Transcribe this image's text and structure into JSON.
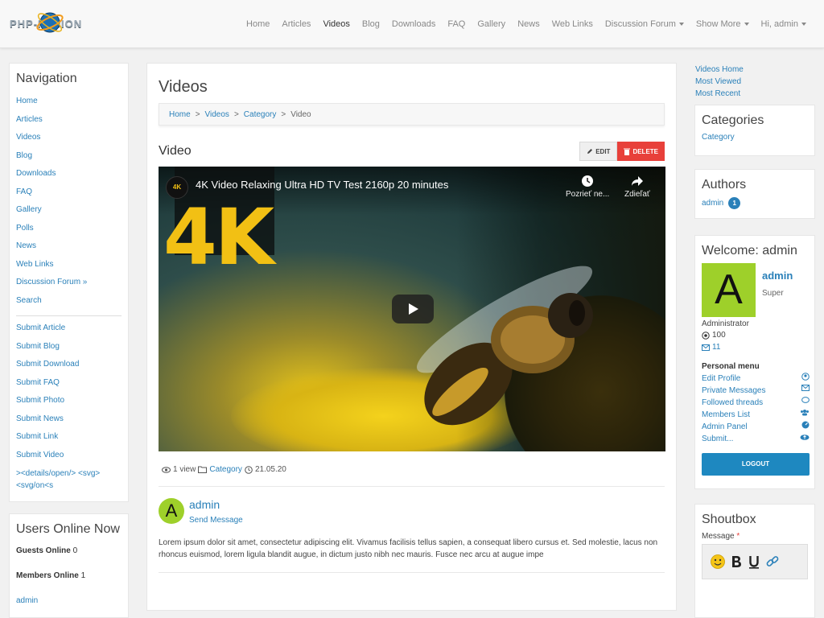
{
  "brand": "PHP-FUSION",
  "topnav": [
    "Home",
    "Articles",
    "Videos",
    "Blog",
    "Downloads",
    "FAQ",
    "Gallery",
    "News",
    "Web Links",
    "Discussion Forum",
    "Show More",
    "Hi, admin"
  ],
  "leftnav": {
    "title": "Navigation",
    "items": [
      "Home",
      "Articles",
      "Videos",
      "Blog",
      "Downloads",
      "FAQ",
      "Gallery",
      "Polls",
      "News",
      "Web Links",
      "Discussion Forum »",
      "Search"
    ],
    "submit": [
      "Submit Article",
      "Submit Blog",
      "Submit Download",
      "Submit FAQ",
      "Submit Photo",
      "Submit News",
      "Submit Link",
      "Submit Video"
    ],
    "raw": "><details/open/> <svg> <svg/on<s"
  },
  "users_online": {
    "title": "Users Online Now",
    "guests_label": "Guests Online",
    "guests_count": "0",
    "members_label": "Members Online",
    "members_count": "1",
    "member": "admin"
  },
  "main": {
    "title": "Videos",
    "breadcrumb": [
      "Home",
      "Videos",
      "Category",
      "Video"
    ],
    "breadcrumb_sep": ">",
    "video_heading": "Video",
    "edit_label": "EDIT",
    "delete_label": "DELETE",
    "player": {
      "title": "4K Video Relaxing Ultra HD TV Test 2160p 20 minutes",
      "overlay": "4K",
      "channel": "4K",
      "watch_later": "Pozrieť ne...",
      "share": "Zdieľať"
    },
    "views": "1 view",
    "category": "Category",
    "date": "21.05.20",
    "author": "admin",
    "author_initial": "A",
    "send_message": "Send Message",
    "body": "Lorem ipsum dolor sit amet, consectetur adipiscing elit. Vivamus facilisis tellus sapien, a consequat libero cursus et. Sed molestie, lacus non rhoncus euismod, lorem ligula blandit augue, in dictum justo nibh nec mauris. Fusce nec arcu at augue impe"
  },
  "right": {
    "links": [
      "Videos Home",
      "Most Viewed",
      "Most Recent"
    ],
    "categories_title": "Categories",
    "categories": [
      "Category"
    ],
    "authors_title": "Authors",
    "author": "admin",
    "author_count": "1",
    "welcome_title": "Welcome: admin",
    "user_name": "admin",
    "user_initial": "A",
    "user_level": "Super",
    "user_role": "Administrator",
    "points": "100",
    "messages": "11",
    "menu_title": "Personal menu",
    "menu": [
      "Edit Profile",
      "Private Messages",
      "Followed threads",
      "Members List",
      "Admin Panel",
      "Submit..."
    ],
    "logout": "LOGOUT",
    "shoutbox_title": "Shoutbox",
    "message_label": "Message",
    "required_mark": "*"
  },
  "colors": {
    "accent": "#2a80b9",
    "danger": "#e8403a",
    "avatar": "#9ed02a",
    "logout": "#1e88c0"
  }
}
